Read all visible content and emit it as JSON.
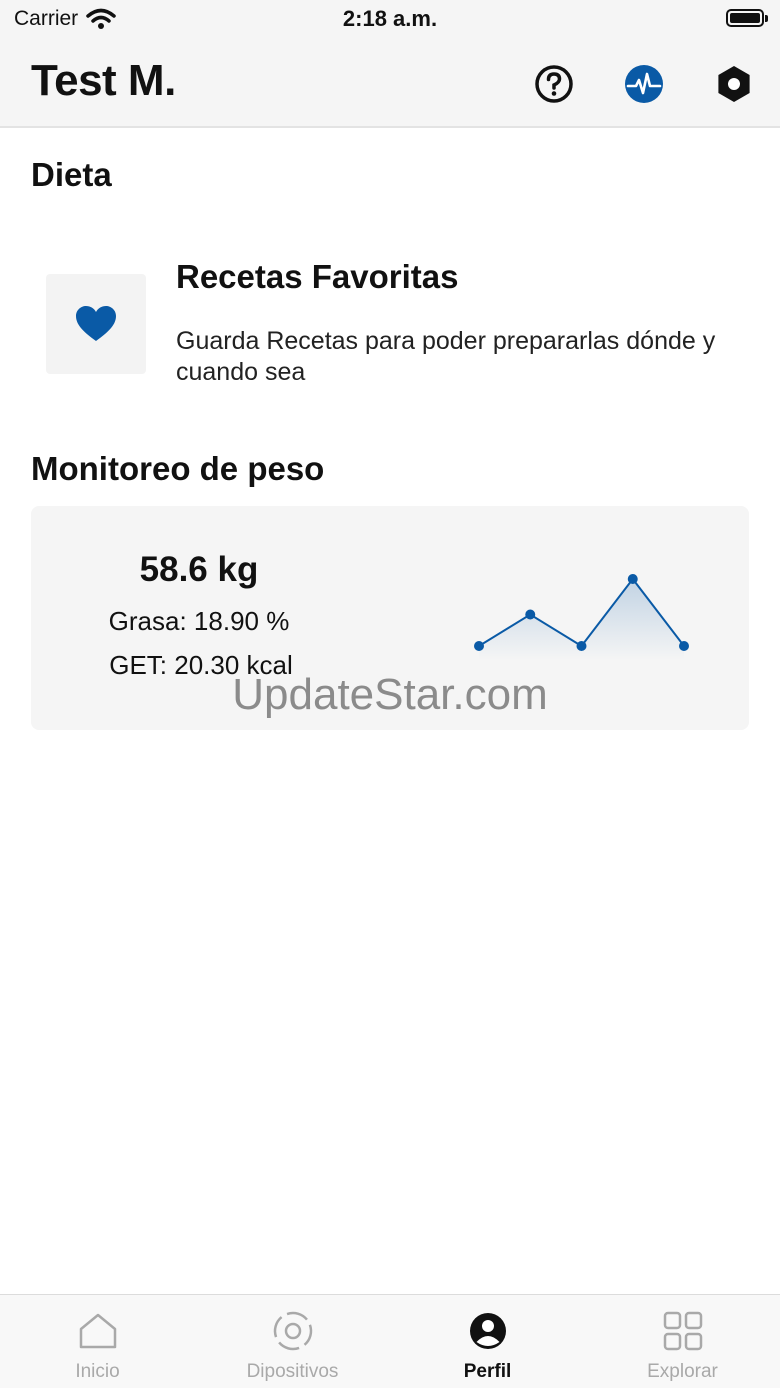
{
  "status_bar": {
    "carrier": "Carrier",
    "time": "2:18 a.m."
  },
  "header": {
    "title": "Test M.",
    "icons": [
      "help-circle-icon",
      "heart-pulse-icon",
      "settings-hexagon-icon"
    ]
  },
  "diet": {
    "section_title": "Dieta",
    "favorites": {
      "title": "Recetas Favoritas",
      "description": "Guarda Recetas para poder prepararlas dónde y cuando sea",
      "icon": "heart-icon"
    }
  },
  "weight": {
    "section_title": "Monitoreo de peso",
    "weight": "58.6 kg",
    "fat": "Grasa: 18.90 %",
    "get": "GET: 20.30 kcal",
    "trend": [
      0.0,
      0.47,
      0.0,
      1.0,
      0.0
    ]
  },
  "watermark": "UpdateStar.com",
  "tabs": [
    {
      "label": "Inicio",
      "icon": "home-icon",
      "active": false
    },
    {
      "label": "Dipositivos",
      "icon": "device-icon",
      "active": false
    },
    {
      "label": "Perfil",
      "icon": "user-circle-icon",
      "active": true
    },
    {
      "label": "Explorar",
      "icon": "grid-icon",
      "active": false
    }
  ],
  "colors": {
    "accent": "#0a5aa6",
    "active_tab": "#111111",
    "inactive_tab": "#a9a9a9"
  }
}
